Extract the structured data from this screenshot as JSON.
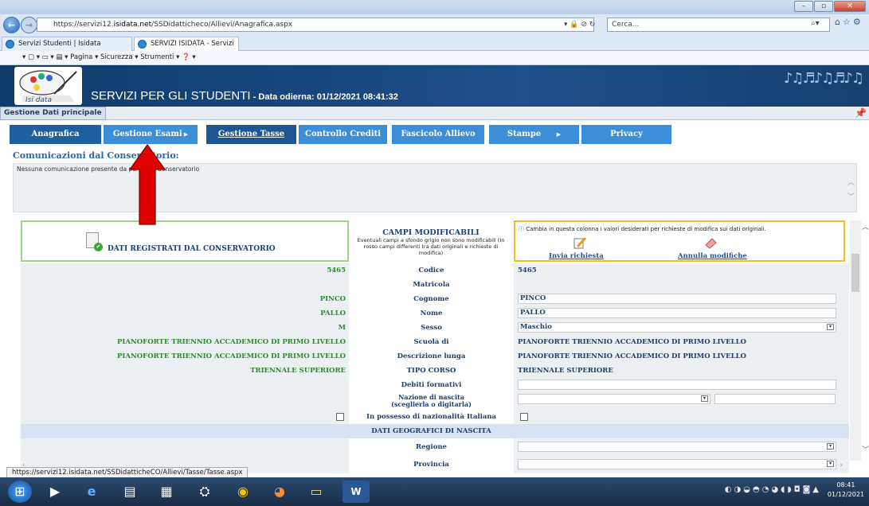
{
  "browser": {
    "url_prefix": "https://servizi12.",
    "url_host": "isidata.net",
    "url_path": "/SSDidatticheco/Allievi/Anagrafica.aspx",
    "address_icons": "▾ 🔒 ⊘ ↻",
    "search_placeholder": "Cerca...",
    "tabs": [
      {
        "label": "Servizi Studenti | Isidata"
      },
      {
        "label": "SERVIZI ISIDATA - Servizi pe...",
        "close": "✕"
      }
    ],
    "command_bar": "▾  ▢  ▾  ▭  ▾  ▤  ▾  Pagina ▾   Sicurezza ▾   Strumenti ▾   ❓ ▾",
    "status_url": "https://servizi12.isidata.net/SSDidatticheCO/Allievi/Tasse/Tasse.aspx"
  },
  "header": {
    "title": "SERVIZI PER GLI STUDENTI",
    "date_label": " - Data odierna: 01/12/2021 08:41:32",
    "logo_text": "Isi data"
  },
  "main_tab": "Gestione Dati principale",
  "menu": [
    {
      "label": "Anagrafica"
    },
    {
      "label": "Gestione Esami"
    },
    {
      "label": "Gestione Tasse"
    },
    {
      "label": "Controllo Crediti"
    },
    {
      "label": "Fascicolo Allievo"
    },
    {
      "label": "Stampe"
    },
    {
      "label": "Privacy"
    }
  ],
  "communications": {
    "title": "Comunicazioni dal Conservatorio:",
    "text": "Nessuna comunicazione presente da parte del Conservatorio"
  },
  "form": {
    "left_title": "DATI REGISTRATI DAL CONSERVATORIO",
    "mid_title": "CAMPI MODIFICABILI",
    "mid_subtitle": "Eventuali campi a sfondo grigio non sono modificabili (In rosso campi differenti tra dati originali e richieste di modifica)",
    "right_note": "Cambia in questa colonna i valori desiderati per richieste di modifica sui dati originali.",
    "invia": "Invia richiesta",
    "annulla": "Annulla modifiche",
    "rows": {
      "codice": {
        "left": "5465",
        "label": "Codice",
        "right": "5465"
      },
      "matricola": {
        "left": "",
        "label": "Matricola",
        "right": ""
      },
      "cognome": {
        "left": "PINCO",
        "label": "Cognome",
        "right": "PINCO"
      },
      "nome": {
        "left": "PALLO",
        "label": "Nome",
        "right": "PALLO"
      },
      "sesso": {
        "left": "M",
        "label": "Sesso",
        "right": "Maschio"
      },
      "scuola": {
        "left": "PIANOFORTE TRIENNIO ACCADEMICO DI PRIMO LIVELLO",
        "label": "Scuola di",
        "right": "PIANOFORTE TRIENNIO ACCADEMICO DI PRIMO LIVELLO"
      },
      "descr": {
        "left": "PIANOFORTE TRIENNIO ACCADEMICO DI PRIMO LIVELLO",
        "label": "Descrizione lunga",
        "right": "PIANOFORTE TRIENNIO ACCADEMICO DI PRIMO LIVELLO"
      },
      "tipo": {
        "left": "TRIENNALE SUPERIORE",
        "label": "TIPO CORSO",
        "right": "TRIENNALE SUPERIORE"
      },
      "debiti": {
        "label": "Debiti formativi",
        "right": ""
      },
      "nazione": {
        "label": "Nazione di nascita",
        "label2": "(sceglierla o digitarla)"
      },
      "nazionalita": {
        "label": "In possesso di nazionalità Italiana"
      },
      "section": "DATI GEOGRAFICI DI NASCITA",
      "regione": {
        "label": "Regione"
      },
      "provincia": {
        "label": "Provincia"
      }
    }
  },
  "clock": {
    "time": "08:41",
    "date": "01/12/2021"
  },
  "colors": {
    "menu_light": "#3b8fd8",
    "menu_dark": "#1f5f9e",
    "header": "#1e4f8a",
    "green_text": "#2d8a2d",
    "annotation_arrow": "#e10000"
  }
}
